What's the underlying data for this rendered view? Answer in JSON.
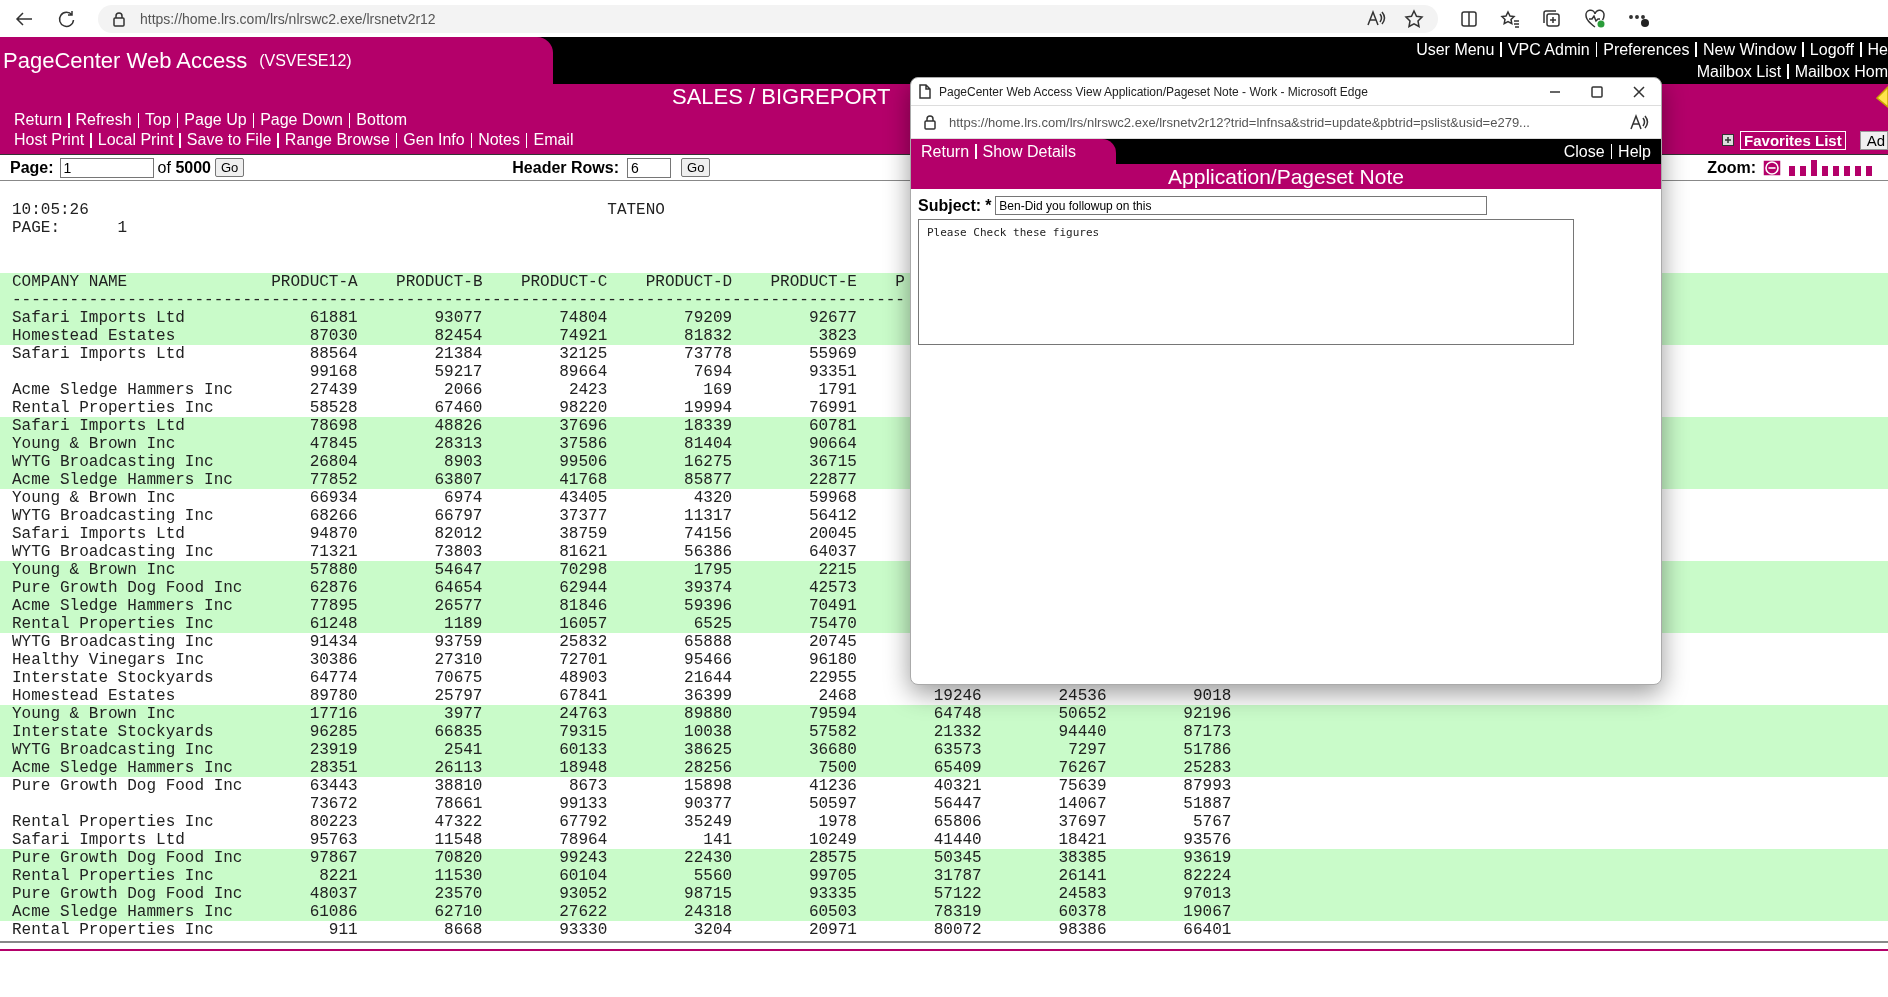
{
  "browser": {
    "url": "https://home.lrs.com/lrs/nlrswc2.exe/lrsnetv2r12"
  },
  "header": {
    "title": "PageCenter Web Access",
    "server": "(VSVESE12)",
    "user_links": [
      [
        "User Menu",
        "VPC Admin",
        "Preferences",
        "New Window",
        "Logoff",
        "He"
      ],
      [
        "Mailbox List",
        "Mailbox Hom"
      ]
    ],
    "report_title": "SALES / BIGREPORT",
    "nav_links": [
      [
        "Return",
        "Refresh",
        "Top",
        "Page Up",
        "Page Down",
        "Bottom"
      ],
      [
        "Host Print",
        "Local Print",
        "Save to File",
        "Range Browse",
        "Gen Info",
        "Notes",
        "Email"
      ]
    ],
    "favorites_button": "Favorites List",
    "cut_button": "Ad"
  },
  "pager": {
    "page_label": "Page:",
    "page": "1",
    "of_label": "of",
    "total": "5000",
    "go": "Go",
    "header_rows_label": "Header Rows:",
    "header_rows": "6",
    "header_go": "Go",
    "zoom_label": "Zoom:"
  },
  "report": {
    "time": "10:05:26",
    "name": "TATENO",
    "page_label": "PAGE:",
    "page": "1",
    "columns": [
      "COMPANY NAME",
      "PRODUCT-A",
      "PRODUCT-B",
      "PRODUCT-C",
      "PRODUCT-D",
      "PRODUCT-E",
      "P"
    ],
    "separator": "---------------------------------------------------------------------------------------------",
    "rows": [
      {
        "company": "Safari Imports Ltd",
        "values": [
          "61881",
          "93077",
          "74804",
          "79209",
          "92677"
        ]
      },
      {
        "company": "Homestead Estates",
        "values": [
          "87030",
          "82454",
          "74921",
          "81832",
          "3823"
        ]
      },
      {
        "company": "Safari Imports Ltd",
        "values": [
          "88564",
          "21384",
          "32125",
          "73778",
          "55969"
        ]
      },
      {
        "values": [
          "99168",
          "59217",
          "89664",
          "7694",
          "93351"
        ]
      },
      {
        "company": "Acme Sledge Hammers Inc",
        "values": [
          "27439",
          "2066",
          "2423",
          "169",
          "1791"
        ]
      },
      {
        "company": "Rental Properties Inc",
        "values": [
          "58528",
          "67460",
          "98220",
          "19994",
          "76991"
        ]
      },
      {
        "company": "Safari Imports Ltd",
        "values": [
          "78698",
          "48826",
          "37696",
          "18339",
          "60781"
        ]
      },
      {
        "company": "Young & Brown Inc",
        "values": [
          "47845",
          "28313",
          "37586",
          "81404",
          "90664"
        ]
      },
      {
        "company": "WYTG Broadcasting Inc",
        "values": [
          "26804",
          "8903",
          "99506",
          "16275",
          "36715"
        ]
      },
      {
        "company": "Acme Sledge Hammers Inc",
        "values": [
          "77852",
          "63807",
          "41768",
          "85877",
          "22877"
        ]
      },
      {
        "company": "Young & Brown Inc",
        "values": [
          "66934",
          "6974",
          "43405",
          "4320",
          "59968"
        ]
      },
      {
        "company": "WYTG Broadcasting Inc",
        "values": [
          "68266",
          "66797",
          "37377",
          "11317",
          "56412"
        ]
      },
      {
        "company": "Safari Imports Ltd",
        "values": [
          "94870",
          "82012",
          "38759",
          "74156",
          "20045"
        ]
      },
      {
        "company": "WYTG Broadcasting Inc",
        "values": [
          "71321",
          "73803",
          "81621",
          "56386",
          "64037"
        ]
      },
      {
        "company": "Young & Brown Inc",
        "values": [
          "57880",
          "54647",
          "70298",
          "1795",
          "2215"
        ]
      },
      {
        "company": "Pure Growth Dog Food Inc",
        "values": [
          "62876",
          "64654",
          "62944",
          "39374",
          "42573"
        ]
      },
      {
        "company": "Acme Sledge Hammers Inc",
        "values": [
          "77895",
          "26577",
          "81846",
          "59396",
          "70491"
        ]
      },
      {
        "company": "Rental Properties Inc",
        "values": [
          "61248",
          "1189",
          "16057",
          "6525",
          "75470"
        ]
      },
      {
        "company": "WYTG Broadcasting Inc",
        "values": [
          "91434",
          "93759",
          "25832",
          "65888",
          "20745"
        ]
      },
      {
        "company": "Healthy Vinegars Inc",
        "values": [
          "30386",
          "27310",
          "72701",
          "95466",
          "96180"
        ]
      },
      {
        "company": "Interstate Stockyards",
        "values": [
          "64774",
          "70675",
          "48903",
          "21644",
          "22955"
        ]
      },
      {
        "company": "Homestead Estates",
        "values": [
          "89780",
          "25797",
          "67841",
          "36399",
          "2468",
          "19246",
          "24536",
          "9018"
        ]
      },
      {
        "company": "Young & Brown Inc",
        "values": [
          "17716",
          "3977",
          "24763",
          "89880",
          "79594",
          "64748",
          "50652",
          "92196"
        ]
      },
      {
        "company": "Interstate Stockyards",
        "values": [
          "96285",
          "66835",
          "79315",
          "10038",
          "57582",
          "21332",
          "94440",
          "87173"
        ]
      },
      {
        "company": "WYTG Broadcasting Inc",
        "values": [
          "23919",
          "2541",
          "60133",
          "38625",
          "36680",
          "63573",
          "7297",
          "51786"
        ]
      },
      {
        "company": "Acme Sledge Hammers Inc",
        "values": [
          "28351",
          "26113",
          "18948",
          "28256",
          "7500",
          "65409",
          "76267",
          "25283"
        ]
      },
      {
        "company": "Pure Growth Dog Food Inc",
        "values": [
          "63443",
          "38810",
          "8673",
          "15898",
          "41236",
          "40321",
          "75639",
          "87993"
        ]
      },
      {
        "values": [
          "73672",
          "78661",
          "99133",
          "90377",
          "50597",
          "56447",
          "14067",
          "51887"
        ]
      },
      {
        "company": "Rental Properties Inc",
        "values": [
          "80223",
          "47322",
          "67792",
          "35249",
          "1978",
          "65806",
          "37697",
          "5767"
        ]
      },
      {
        "company": "Safari Imports Ltd",
        "values": [
          "95763",
          "11548",
          "78964",
          "141",
          "10249",
          "41440",
          "18421",
          "93576"
        ]
      },
      {
        "company": "Pure Growth Dog Food Inc",
        "values": [
          "97867",
          "70820",
          "99243",
          "22430",
          "28575",
          "50345",
          "38385",
          "93619"
        ]
      },
      {
        "company": "Rental Properties Inc",
        "values": [
          "8221",
          "11530",
          "60104",
          "5560",
          "99705",
          "31787",
          "26141",
          "82224"
        ]
      },
      {
        "company": "Pure Growth Dog Food Inc",
        "values": [
          "48037",
          "23570",
          "93052",
          "98715",
          "93335",
          "57122",
          "24583",
          "97013"
        ]
      },
      {
        "company": "Acme Sledge Hammers Inc",
        "values": [
          "61086",
          "62710",
          "27622",
          "24318",
          "60503",
          "78319",
          "60378",
          "19067"
        ]
      },
      {
        "company": "Rental Properties Inc",
        "values": [
          "911",
          "8668",
          "93330",
          "3204",
          "20971",
          "80072",
          "98386",
          "66401"
        ]
      }
    ]
  },
  "popup": {
    "window_title": "PageCenter Web Access View Application/Pageset Note - Work - Microsoft Edge",
    "url": "https://home.lrs.com/lrs/nlrswc2.exe/lrsnetv2r12?trid=lnfnsa&strid=update&pbtrid=pslist&usid=e279...",
    "left_links": [
      "Return",
      "Show Details"
    ],
    "right_links": [
      "Close",
      "Help"
    ],
    "heading": "Application/Pageset Note",
    "subject_label": "Subject:",
    "required_mark": "*",
    "subject": "Ben-Did you followup on this",
    "note": "Please Check these figures"
  }
}
